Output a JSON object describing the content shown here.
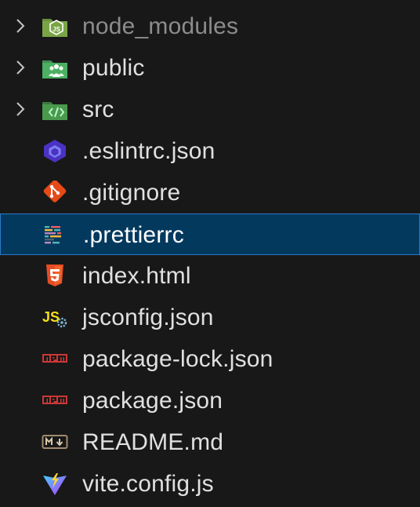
{
  "explorer": {
    "items": [
      {
        "label": "node_modules",
        "kind": "folder",
        "icon": "folder-node-icon",
        "dimmed": true
      },
      {
        "label": "public",
        "kind": "folder",
        "icon": "folder-public-icon"
      },
      {
        "label": "src",
        "kind": "folder",
        "icon": "folder-src-icon"
      },
      {
        "label": ".eslintrc.json",
        "kind": "file",
        "icon": "eslint-icon"
      },
      {
        "label": ".gitignore",
        "kind": "file",
        "icon": "git-icon"
      },
      {
        "label": ".prettierrc",
        "kind": "file",
        "icon": "prettier-icon",
        "selected": true
      },
      {
        "label": "index.html",
        "kind": "file",
        "icon": "html5-icon"
      },
      {
        "label": "jsconfig.json",
        "kind": "file",
        "icon": "jsconfig-icon"
      },
      {
        "label": "package-lock.json",
        "kind": "file",
        "icon": "npm-icon"
      },
      {
        "label": "package.json",
        "kind": "file",
        "icon": "npm-icon"
      },
      {
        "label": "README.md",
        "kind": "file",
        "icon": "markdown-icon"
      },
      {
        "label": "vite.config.js",
        "kind": "file",
        "icon": "vite-icon"
      }
    ]
  },
  "colors": {
    "background": "#181818",
    "selection": "#04395e",
    "selection_border": "#2b79c6",
    "text": "#e0e0e0",
    "text_dimmed": "#8c8c8c"
  }
}
